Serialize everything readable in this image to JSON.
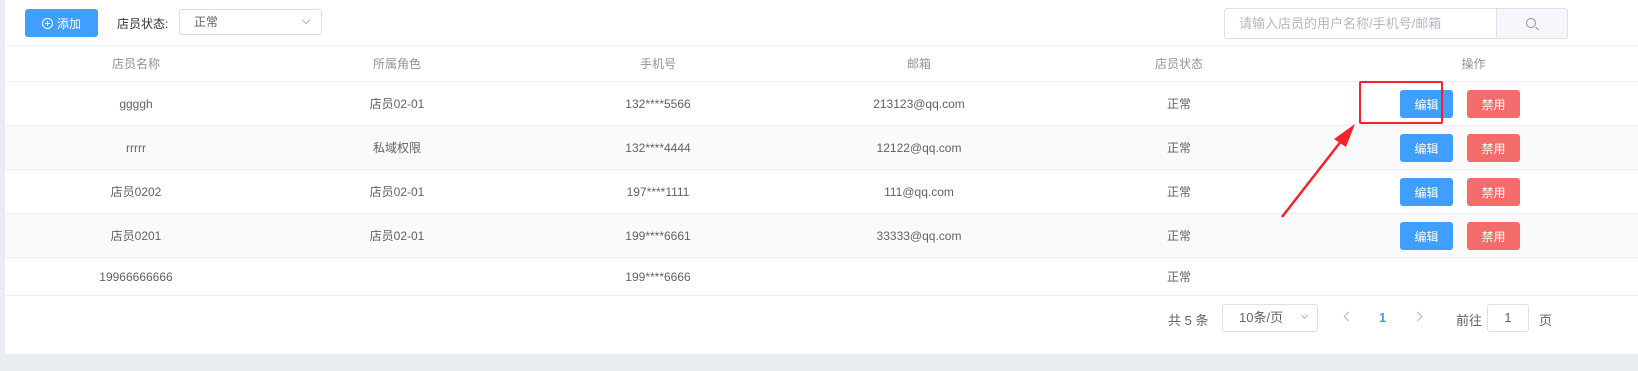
{
  "toolbar": {
    "add_label": "添加",
    "status_label": "店员状态:",
    "status_value": "正常",
    "search_placeholder": "请输入店员的用户名称/手机号/邮箱"
  },
  "table": {
    "headers": [
      "店员名称",
      "所属角色",
      "手机号",
      "邮箱",
      "店员状态",
      "操作"
    ],
    "rows": [
      {
        "name": "ggggh",
        "role": "店员02-01",
        "phone": "132****5566",
        "email": "213123@qq.com",
        "status": "正常",
        "edit": "编辑",
        "disable": "禁用"
      },
      {
        "name": "rrrrr",
        "role": "私域权限",
        "phone": "132****4444",
        "email": "12122@qq.com",
        "status": "正常",
        "edit": "编辑",
        "disable": "禁用"
      },
      {
        "name": "店员0202",
        "role": "店员02-01",
        "phone": "197****1111",
        "email": "111@qq.com",
        "status": "正常",
        "edit": "编辑",
        "disable": "禁用"
      },
      {
        "name": "店员0201",
        "role": "店员02-01",
        "phone": "199****6661",
        "email": "33333@qq.com",
        "status": "正常",
        "edit": "编辑",
        "disable": "禁用"
      },
      {
        "name": "19966666666",
        "role": "",
        "phone": "199****6666",
        "email": "",
        "status": "正常"
      }
    ]
  },
  "pagination": {
    "total": "共 5 条",
    "page_size": "10条/页",
    "current_page": "1",
    "goto_label": "前往",
    "goto_value": "1",
    "page_unit": "页"
  },
  "colors": {
    "primary": "#409eff",
    "danger": "#f56c6c",
    "annotation": "#f5222d"
  }
}
